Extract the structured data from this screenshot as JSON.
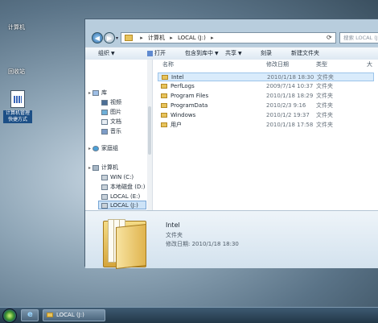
{
  "desktop": {
    "label1": "计算机",
    "label2": "回收站",
    "icon_label_line1": "计算机管理",
    "icon_label_line2": "快捷方式"
  },
  "address": {
    "root": "计算机",
    "location": "LOCAL (J:)",
    "search_placeholder": "搜索 LOCAL (J:)"
  },
  "toolbar": {
    "organize": "组织",
    "open": "打开",
    "include": "包含到库中",
    "share": "共享",
    "burn": "刻录",
    "new_folder": "新建文件夹"
  },
  "nav": {
    "library": "库",
    "videos": "视频",
    "pictures": "图片",
    "documents": "文档",
    "music": "音乐",
    "homegroup": "家庭组",
    "computer": "计算机",
    "drive_c": "WIN (C:)",
    "drive_d": "本地磁盘 (D:)",
    "drive_e": "LOCAL (E:)",
    "drive_j": "LOCAL (J:)",
    "network": "网络"
  },
  "columns": {
    "name": "名称",
    "date": "修改日期",
    "type": "类型",
    "size": "大"
  },
  "files": [
    {
      "name": "Intel",
      "date": "2010/1/18 18:30",
      "type": "文件夹"
    },
    {
      "name": "PerfLogs",
      "date": "2009/7/14 10:37",
      "type": "文件夹"
    },
    {
      "name": "Program Files",
      "date": "2010/1/18 18:29",
      "type": "文件夹"
    },
    {
      "name": "ProgramData",
      "date": "2010/2/3 9:16",
      "type": "文件夹"
    },
    {
      "name": "Windows",
      "date": "2010/1/2 19:37",
      "type": "文件夹"
    },
    {
      "name": "用户",
      "date": "2010/1/18 17:58",
      "type": "文件夹"
    }
  ],
  "details": {
    "name": "Intel",
    "type": "文件夹",
    "date_label": "修改日期:",
    "date": "2010/1/18 18:30"
  },
  "taskbar": {
    "explorer_label": "LOCAL (J:)"
  }
}
